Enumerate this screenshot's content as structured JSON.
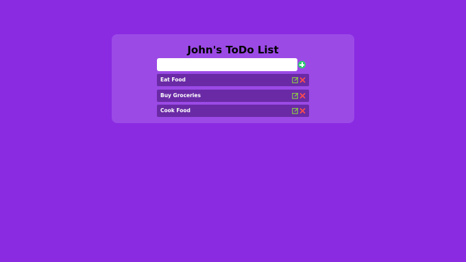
{
  "app": {
    "title": "John's ToDo List"
  },
  "input": {
    "value": "",
    "placeholder": ""
  },
  "todos": [
    {
      "text": "Eat Food"
    },
    {
      "text": "Buy Groceries"
    },
    {
      "text": "Cook Food"
    }
  ],
  "icons": {
    "add": "plus-circle-icon",
    "edit": "edit-icon",
    "delete": "close-icon"
  },
  "colors": {
    "background": "#8a2be2",
    "card": "#9b4ae6",
    "item": "#6a2aa6",
    "add": "#2ecc71",
    "edit": "#8bc34a",
    "delete": "#ff4d4d"
  }
}
